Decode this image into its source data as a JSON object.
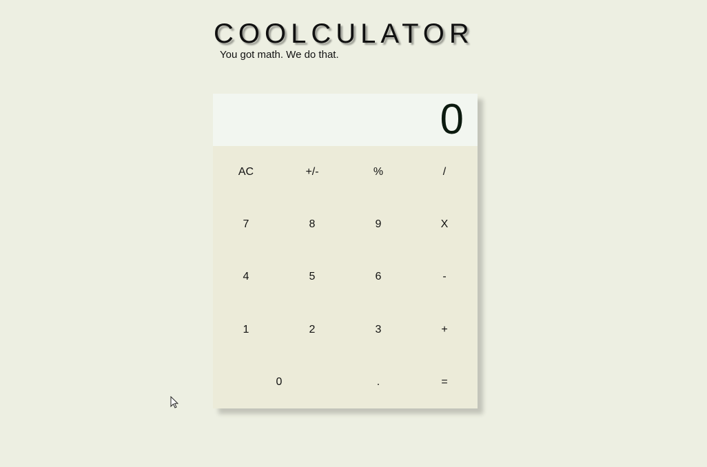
{
  "header": {
    "title": "COOLCULATOR",
    "subtitle": "You got math. We do that."
  },
  "display": {
    "value": "0"
  },
  "keys": {
    "clear": "AC",
    "sign": "+/-",
    "percent": "%",
    "divide": "/",
    "seven": "7",
    "eight": "8",
    "nine": "9",
    "multiply": "X",
    "four": "4",
    "five": "5",
    "six": "6",
    "subtract": "-",
    "one": "1",
    "two": "2",
    "three": "3",
    "add": "+",
    "zero": "0",
    "decimal": ".",
    "equals": "="
  },
  "colors": {
    "page_background": "#edefe2",
    "display_background": "#f2f6f0",
    "keypad_background": "#ecebd9"
  },
  "icons": {
    "pointer": "mouse-pointer-icon"
  }
}
